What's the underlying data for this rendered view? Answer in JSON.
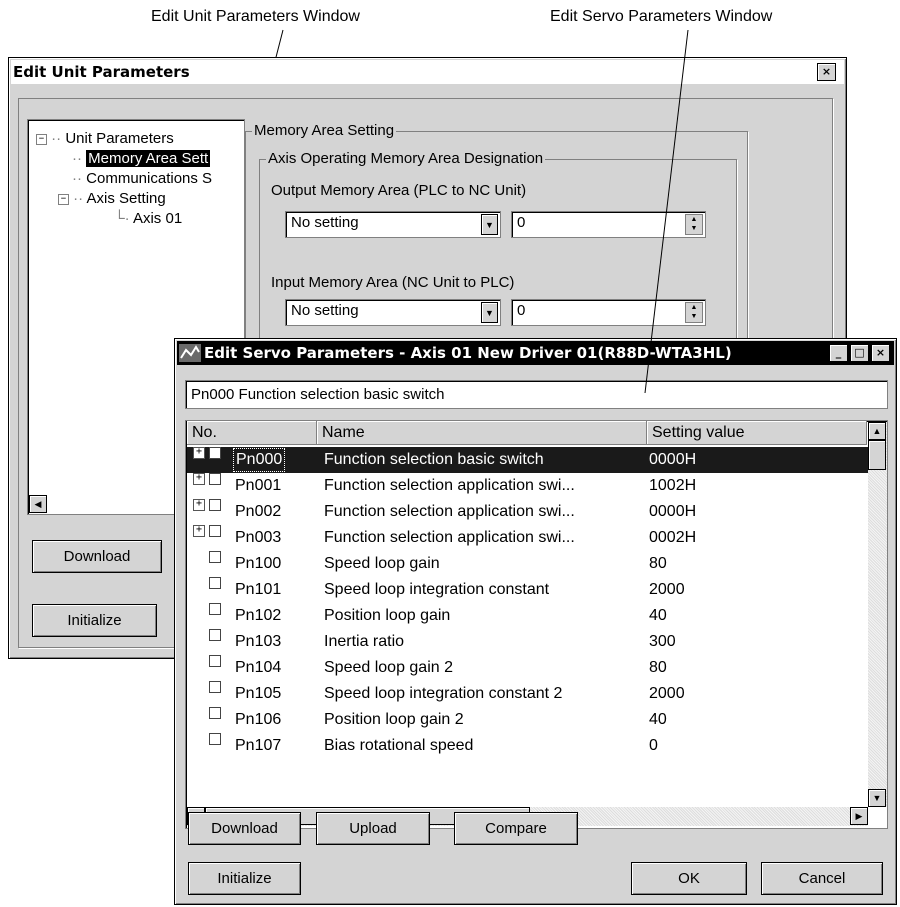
{
  "callouts": {
    "unit_window": "Edit Unit Parameters Window",
    "servo_window": "Edit Servo Parameters Window"
  },
  "unit_window": {
    "title": "Edit Unit Parameters",
    "close_glyph": "×",
    "tree": {
      "root": "Unit Parameters",
      "items": [
        "Memory Area Sett",
        "Communications S",
        "Axis Setting",
        "Axis 01"
      ]
    },
    "memory_group_label": "Memory Area Setting",
    "axis_group_label": "Axis Operating Memory Area Designation",
    "output_label": "Output Memory Area (PLC to NC Unit)",
    "output_select": "No setting",
    "output_value": "0",
    "input_label": "Input Memory Area (NC Unit to PLC)",
    "input_select": "No setting",
    "input_value": "0",
    "download_label": "Download",
    "initialize_label": "Initialize"
  },
  "servo_window": {
    "title": "Edit Servo Parameters - Axis 01 New Driver 01(R88D-WTA3HL)",
    "description": "Pn000 Function selection basic switch",
    "columns": [
      "No.",
      "Name",
      "Setting value"
    ],
    "rows": [
      {
        "no": "Pn000",
        "name": "Function selection basic switch",
        "value": "0000H",
        "expandable": true,
        "selected": true
      },
      {
        "no": "Pn001",
        "name": "Function selection application swi...",
        "value": "1002H",
        "expandable": true
      },
      {
        "no": "Pn002",
        "name": "Function selection application swi...",
        "value": "0000H",
        "expandable": true
      },
      {
        "no": "Pn003",
        "name": "Function selection application swi...",
        "value": "0002H",
        "expandable": true
      },
      {
        "no": "Pn100",
        "name": "Speed loop gain",
        "value": "80"
      },
      {
        "no": "Pn101",
        "name": "Speed loop integration constant",
        "value": "2000"
      },
      {
        "no": "Pn102",
        "name": "Position loop gain",
        "value": "40"
      },
      {
        "no": "Pn103",
        "name": "Inertia ratio",
        "value": "300"
      },
      {
        "no": "Pn104",
        "name": "Speed loop gain 2",
        "value": "80"
      },
      {
        "no": "Pn105",
        "name": "Speed loop integration constant 2",
        "value": "2000"
      },
      {
        "no": "Pn106",
        "name": "Position loop gain 2",
        "value": "40"
      },
      {
        "no": "Pn107",
        "name": "Bias rotational speed",
        "value": "0"
      }
    ],
    "buttons": {
      "download": "Download",
      "upload": "Upload",
      "compare": "Compare",
      "initialize": "Initialize",
      "ok": "OK",
      "cancel": "Cancel"
    }
  }
}
